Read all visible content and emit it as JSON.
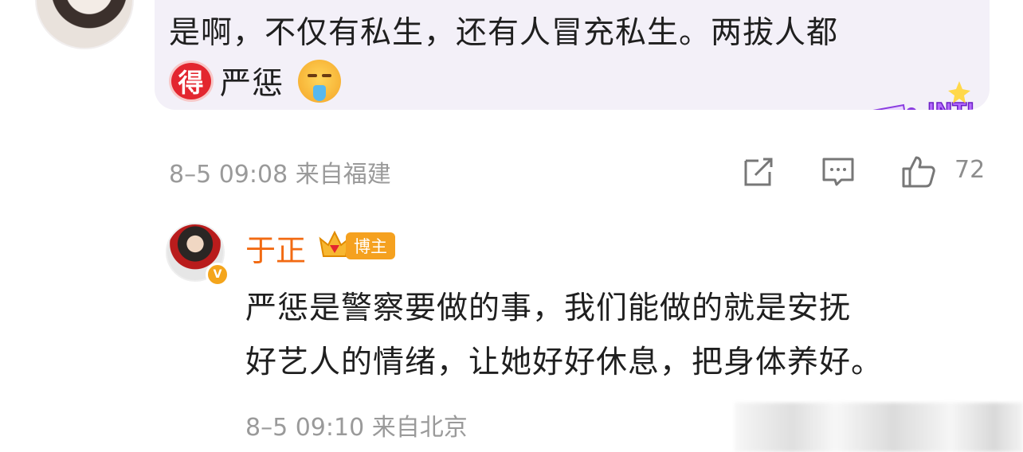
{
  "comment1": {
    "text_line1": "是啊，不仅有私生，还有人冒充私生。两拔人都",
    "badge_char": "得",
    "text_line2": "严惩",
    "emoji": "drooling-face-emoji",
    "sticker": "INTJ",
    "meta": "8–5 09:08  来自福建",
    "like_count": "72"
  },
  "comment2": {
    "username": "于正",
    "badge_label": "博主",
    "text_line1": "严惩是警察要做的事，我们能做的就是安抚",
    "text_line2": "好艺人的情绪，让她好好休息，把身体养好。",
    "meta": "8–5 09:10  来自北京"
  },
  "colors": {
    "username": "#f26a12",
    "bubble": "#f3f0f8",
    "meta": "#9a9a9a",
    "badge_orange": "#f5a11f",
    "red_badge": "#e3262f"
  },
  "icons": [
    "share-icon",
    "comment-icon",
    "like-icon",
    "crown-icon",
    "verified-icon"
  ]
}
